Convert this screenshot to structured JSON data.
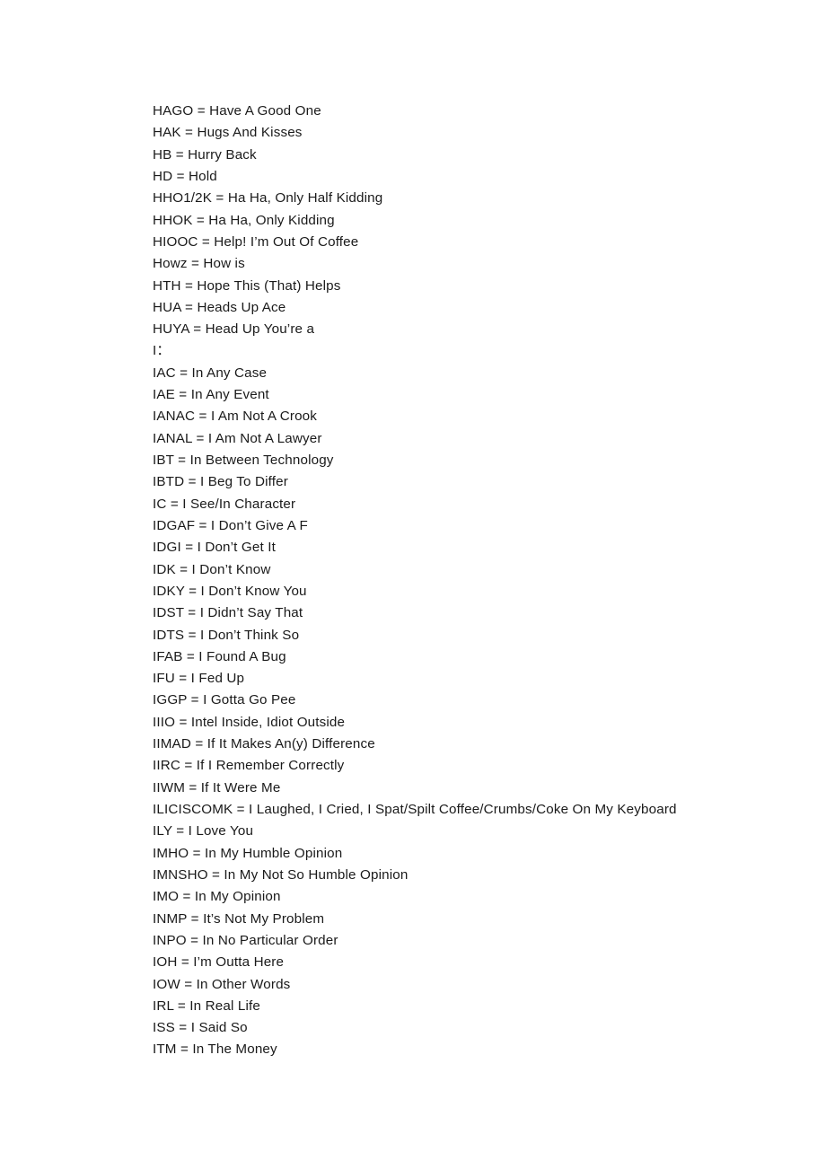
{
  "document": {
    "background_color": "#ffffff",
    "text_color": "#1a1a1a",
    "lines": [
      {
        "text": "HAGO = Have A Good One",
        "type": "entry"
      },
      {
        "text": "HAK = Hugs And Kisses",
        "type": "entry"
      },
      {
        "text": "HB = Hurry Back",
        "type": "entry"
      },
      {
        "text": "HD = Hold",
        "type": "entry"
      },
      {
        "text": "HHO1/2K = Ha Ha, Only Half Kidding",
        "type": "entry"
      },
      {
        "text": "HHOK = Ha Ha, Only Kidding",
        "type": "entry"
      },
      {
        "text": "HIOOC = Help! I’m Out Of Coffee",
        "type": "entry"
      },
      {
        "text": "Howz = How is",
        "type": "entry"
      },
      {
        "text": "HTH = Hope This (That) Helps",
        "type": "entry"
      },
      {
        "text": "HUA = Heads Up Ace",
        "type": "entry"
      },
      {
        "text": "HUYA = Head Up You’re a",
        "type": "entry"
      },
      {
        "text": "I：",
        "type": "section-head"
      },
      {
        "text": "IAC = In Any Case",
        "type": "entry"
      },
      {
        "text": "IAE = In Any Event",
        "type": "entry"
      },
      {
        "text": "IANAC = I Am Not A Crook",
        "type": "entry"
      },
      {
        "text": "IANAL = I Am Not A Lawyer",
        "type": "entry"
      },
      {
        "text": "IBT = In Between Technology",
        "type": "entry"
      },
      {
        "text": "IBTD = I Beg To Differ",
        "type": "entry"
      },
      {
        "text": "IC = I See/In Character",
        "type": "entry"
      },
      {
        "text": "IDGAF = I Don’t Give A F",
        "type": "entry"
      },
      {
        "text": "IDGI = I Don’t Get It",
        "type": "entry"
      },
      {
        "text": "IDK = I Don’t Know",
        "type": "entry"
      },
      {
        "text": "IDKY = I Don’t Know You",
        "type": "entry"
      },
      {
        "text": "IDST = I Didn’t Say That",
        "type": "entry"
      },
      {
        "text": "IDTS = I Don’t Think So",
        "type": "entry"
      },
      {
        "text": "IFAB = I Found A Bug",
        "type": "entry"
      },
      {
        "text": "IFU = I Fed Up",
        "type": "entry"
      },
      {
        "text": "IGGP = I Gotta Go Pee",
        "type": "entry"
      },
      {
        "text": "IIIO = Intel Inside, Idiot Outside",
        "type": "entry"
      },
      {
        "text": "IIMAD = If It Makes An(y) Difference",
        "type": "entry"
      },
      {
        "text": "IIRC = If I Remember Correctly",
        "type": "entry"
      },
      {
        "text": "IIWM = If It Were Me",
        "type": "entry"
      },
      {
        "text": "ILICISCOMK = I Laughed, I Cried, I Spat/Spilt Coffee/Crumbs/Coke On My Keyboard",
        "type": "entry"
      },
      {
        "text": "ILY = I Love You",
        "type": "entry"
      },
      {
        "text": "IMHO = In My Humble Opinion",
        "type": "entry"
      },
      {
        "text": "IMNSHO = In My Not So Humble Opinion",
        "type": "entry"
      },
      {
        "text": "IMO = In My Opinion",
        "type": "entry"
      },
      {
        "text": "INMP = It’s Not My Problem",
        "type": "entry"
      },
      {
        "text": "INPO = In No Particular Order",
        "type": "entry"
      },
      {
        "text": "IOH = I’m Outta Here",
        "type": "entry"
      },
      {
        "text": "IOW = In Other Words",
        "type": "entry"
      },
      {
        "text": "IRL = In Real Life",
        "type": "entry"
      },
      {
        "text": "ISS = I Said So",
        "type": "entry"
      },
      {
        "text": "ITM = In The Money",
        "type": "entry"
      }
    ]
  }
}
